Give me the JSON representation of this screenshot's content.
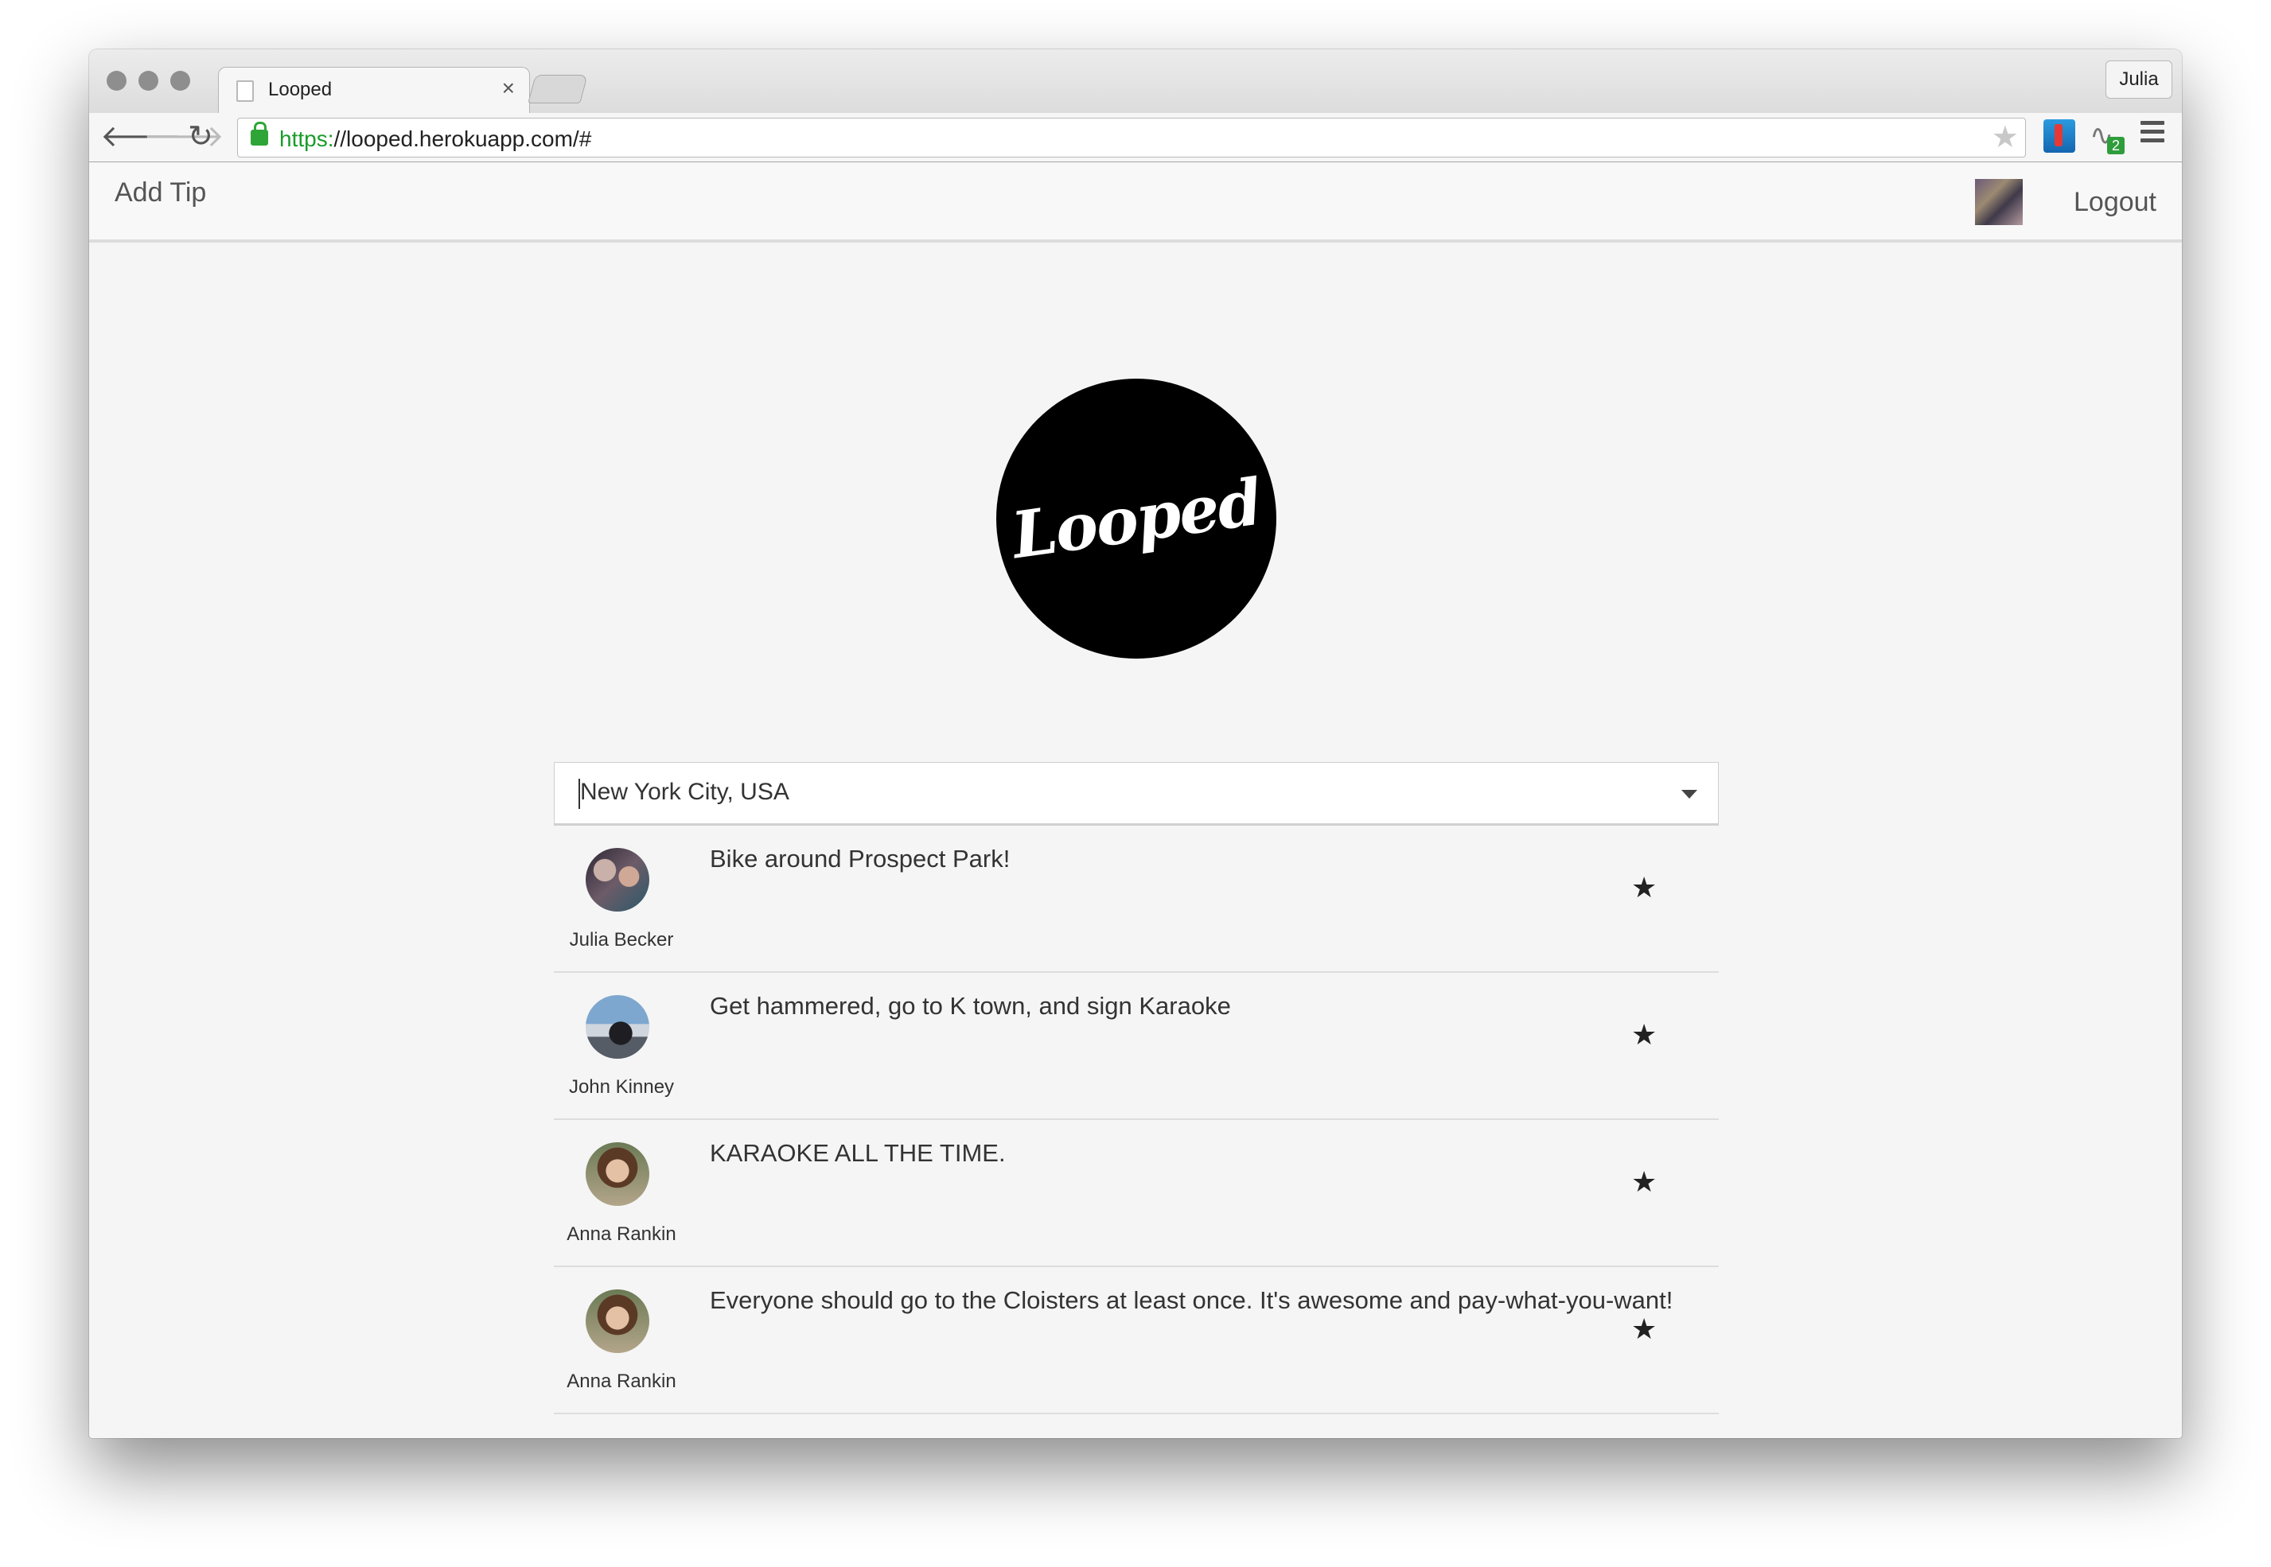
{
  "browser": {
    "tab_title": "Looped",
    "tab_close": "×",
    "profile_name": "Julia",
    "url_scheme": "https:",
    "url_rest": "//looped.herokuapp.com/#",
    "extension_badge": "2"
  },
  "nav": {
    "add_tip_label": "Add Tip",
    "logout_label": "Logout"
  },
  "logo": {
    "text": "Looped"
  },
  "city_select": {
    "value": "New York City, USA"
  },
  "tips": [
    {
      "author": "Julia Becker",
      "text": "Bike around Prospect Park!"
    },
    {
      "author": "John Kinney",
      "text": "Get hammered, go to K town, and sign Karaoke"
    },
    {
      "author": "Anna Rankin",
      "text": "KARAOKE ALL THE TIME."
    },
    {
      "author": "Anna Rankin",
      "text": "Everyone should go to the Cloisters at least once. It's awesome and pay-what-you-want!"
    }
  ]
}
